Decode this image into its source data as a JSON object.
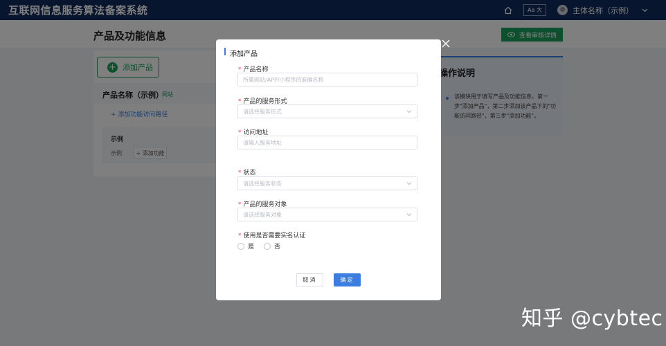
{
  "app": {
    "title": "互联网信息服务算法备案系统",
    "font_toggle": "Aa 大",
    "user_name": "主体名称（示例）"
  },
  "page": {
    "title": "产品及功能信息",
    "review_button": "查看审核详情",
    "add_product_button": "添加产品",
    "product_name": "产品名称（示例）",
    "product_tag": "网站",
    "add_path_link": "+ 添加功能访问路径",
    "example_title": "示例",
    "example_label": "示例",
    "add_function_button": "+ 添加功能"
  },
  "help_panel": {
    "title": "操作说明",
    "text": "该模块用于填写产品及功能信息。第一步\"添加产品\"，第二步添加该产品下的\"功能访问路径\"，第三步\"添加功能\"。"
  },
  "modal": {
    "title": "添加产品",
    "fields": [
      {
        "label": "产品名称",
        "placeholder": "所属网站/APP/小程序的准确名称"
      },
      {
        "label": "产品的服务形式",
        "placeholder": "请选择服务形式"
      },
      {
        "label": "访问地址",
        "placeholder": "请输入服务地址"
      },
      {
        "label": "状态",
        "placeholder": "请选择服务状态"
      },
      {
        "label": "产品的服务对象",
        "placeholder": "请选择服务对象"
      }
    ],
    "realname": {
      "label": "使用是否需要实名认证",
      "options": [
        "是",
        "否"
      ]
    },
    "cancel": "取消",
    "confirm": "确定"
  },
  "watermark": "知乎 @cybtec",
  "colors": {
    "header_bg": "#0f2a5c",
    "brand_green": "#1aa05d",
    "primary_blue": "#3b7ee0",
    "required_red": "#e64545"
  },
  "icons": [
    "home-icon",
    "chevron-down-icon",
    "eye-icon",
    "plus-circle-icon",
    "close-icon",
    "dropdown-arrow-icon"
  ]
}
